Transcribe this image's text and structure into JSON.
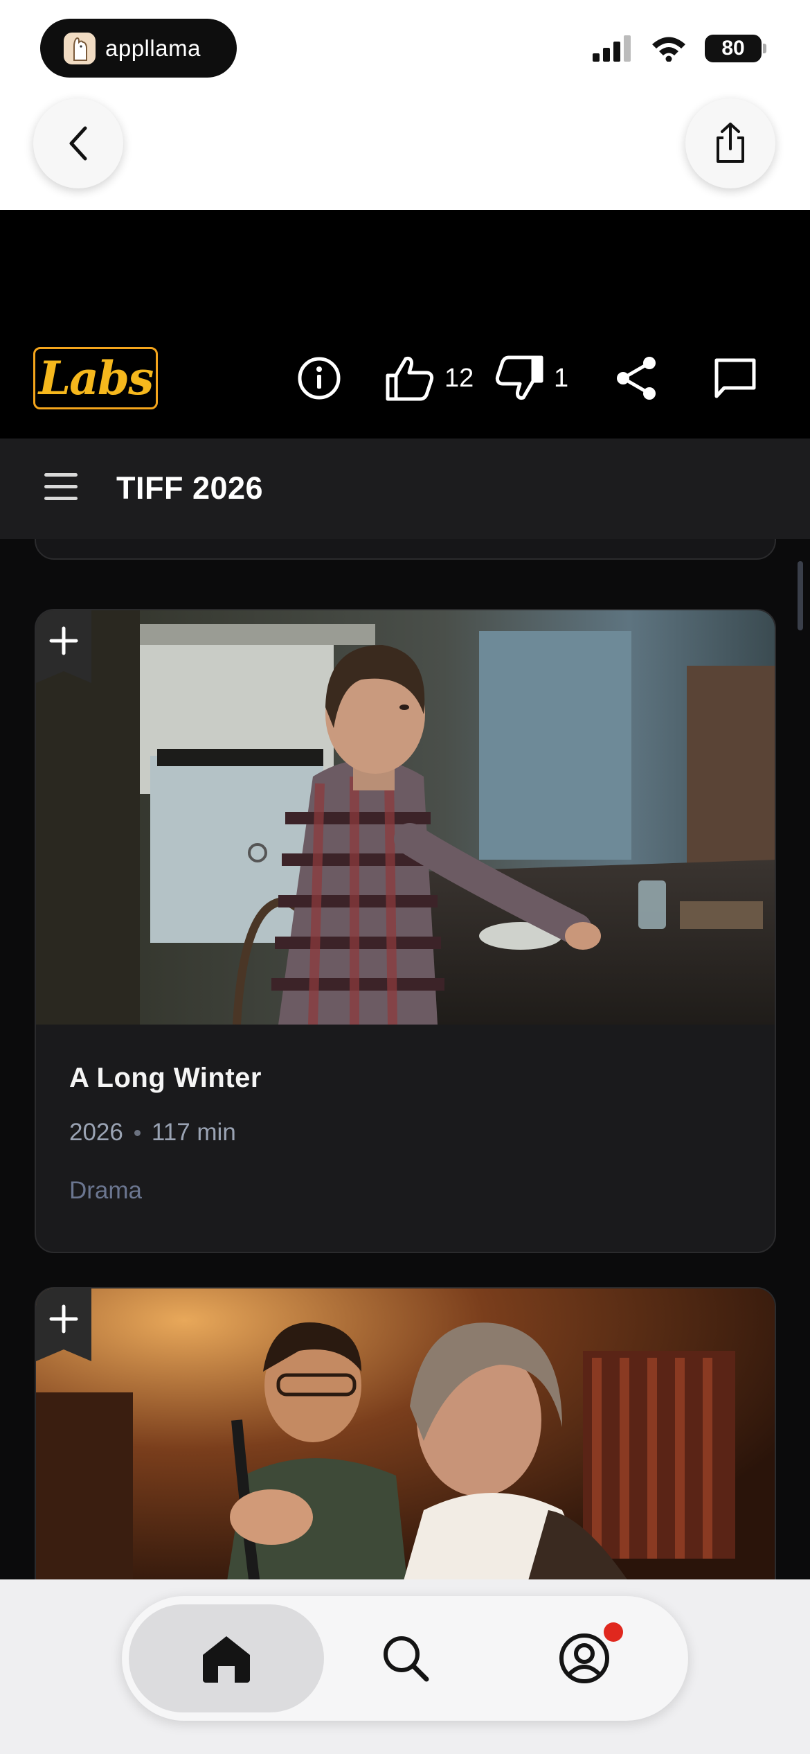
{
  "status": {
    "app_pill_label": "appllama",
    "battery": "80"
  },
  "header": {
    "logo_text": "Labs",
    "likes": "12",
    "dislikes": "1"
  },
  "subbar": {
    "title": "TIFF 2026"
  },
  "films": [
    {
      "title": "A Long Winter",
      "year": "2026",
      "runtime": "117 min",
      "genre": "Drama"
    }
  ],
  "icons": {
    "back": "chevron-left-icon",
    "share_browser": "share-up-icon",
    "info": "info-icon",
    "like": "thumbs-up-icon",
    "dislike": "thumbs-down-icon",
    "share": "share-nodes-icon",
    "comment": "comment-icon",
    "menu": "hamburger-icon",
    "add": "plus-icon",
    "home": "home-icon",
    "search": "search-icon",
    "profile": "profile-icon"
  },
  "colors": {
    "accent": "#f6b81d",
    "notification": "#e0281e"
  }
}
